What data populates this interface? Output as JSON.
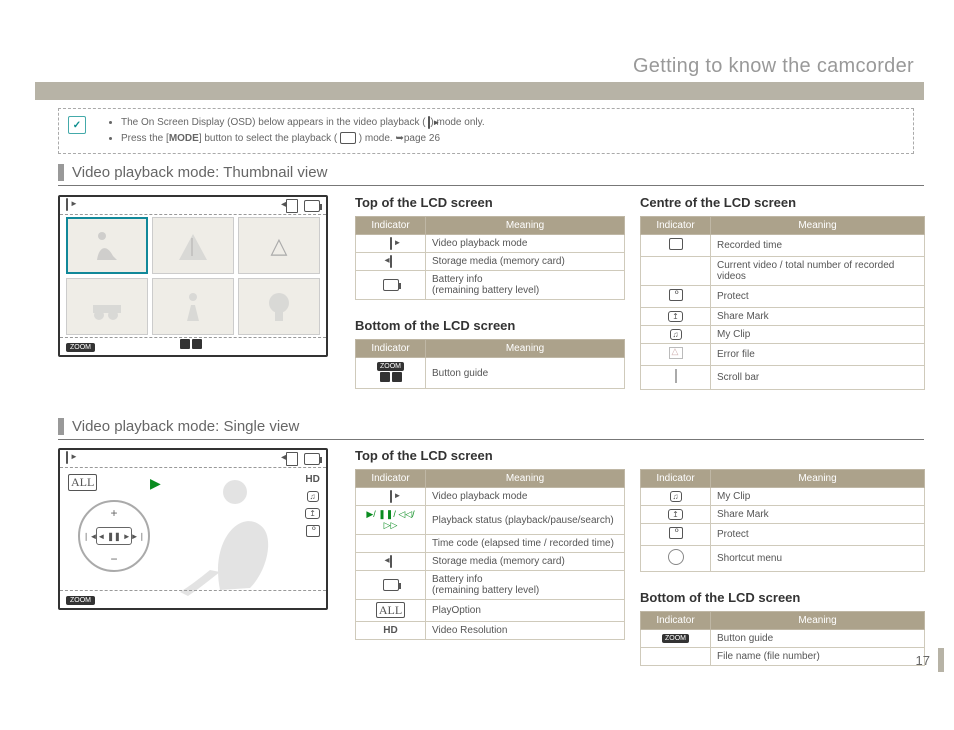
{
  "page": {
    "title": "Getting to know the camcorder",
    "number": "17"
  },
  "notes": {
    "line1_a": "The On Screen Display (OSD) below appears in the video playback (",
    "line1_b": ") mode only.",
    "line2_a": "Press the [",
    "line2_b": "MODE",
    "line2_c": "] button to select the playback (",
    "line2_d": ") mode. ",
    "line2_e": "page 26",
    "check": "✓"
  },
  "sections": {
    "s1": "Video playback mode: Thumbnail view",
    "s2": "Video playback mode: Single view"
  },
  "lcd": {
    "zoom": "ZOOM",
    "hd": "HD"
  },
  "headers": {
    "indicator": "Indicator",
    "meaning": "Meaning"
  },
  "thumb": {
    "top_h": "Top of the LCD screen",
    "top": [
      {
        "m": "Video playback mode"
      },
      {
        "m": "Storage media (memory card)"
      },
      {
        "m": "Battery info\n(remaining battery level)"
      }
    ],
    "bot_h": "Bottom of the LCD screen",
    "bot": [
      {
        "m": "Button guide"
      }
    ],
    "centre_h": "Centre of the LCD screen",
    "centre": [
      {
        "m": "Recorded time"
      },
      {
        "m": "Current video / total number of recorded videos"
      },
      {
        "m": "Protect"
      },
      {
        "m": "Share Mark"
      },
      {
        "m": "My Clip"
      },
      {
        "m": "Error file"
      },
      {
        "m": "Scroll bar"
      }
    ]
  },
  "single": {
    "top_h": "Top of the LCD screen",
    "topL": [
      {
        "m": "Video playback mode"
      },
      {
        "m": "Playback status (playback/pause/search)"
      },
      {
        "m": "Time code (elapsed time / recorded time)"
      },
      {
        "m": "Storage media (memory card)"
      },
      {
        "m": "Battery info\n(remaining battery level)"
      },
      {
        "m": "PlayOption"
      },
      {
        "m": "Video Resolution"
      }
    ],
    "topR": [
      {
        "m": "My Clip"
      },
      {
        "m": "Share Mark"
      },
      {
        "m": "Protect"
      },
      {
        "m": "Shortcut menu"
      }
    ],
    "bot_h": "Bottom of the LCD screen",
    "bot": [
      {
        "m": "Button guide"
      },
      {
        "m": "File name (file number)"
      }
    ]
  },
  "icons": {
    "share": "↥",
    "clip": "♫",
    "play_ctrl": "▶/ ❚❚/ ◁◁/▷▷"
  }
}
